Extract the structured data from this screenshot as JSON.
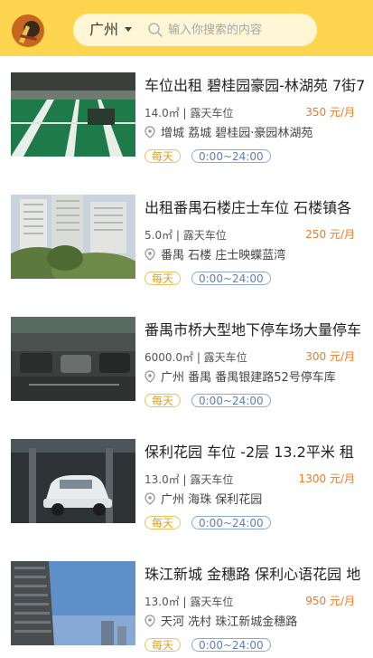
{
  "header": {
    "city": "广州",
    "search_placeholder": "输入你搜索的内容"
  },
  "colors": {
    "header_bg": "#fdd54f",
    "price": "#f07a22",
    "tag_day": "#e0a21c",
    "tag_time": "#5b7fbf"
  },
  "listings": [
    {
      "title": "车位出租 碧桂园豪园-林湖苑 7街7",
      "area": "14.0㎡",
      "type": "露天车位",
      "price": "350 元/月",
      "location": "增城  荔城  碧桂园·豪园林湖苑",
      "tag_day": "每天",
      "tag_time": "0:00~24:00"
    },
    {
      "title": "出租番禺石楼庄士车位 石楼镇各",
      "area": "5.0㎡",
      "type": "露天车位",
      "price": "250 元/月",
      "location": "番禺  石楼  庄士映蝶蓝湾",
      "tag_day": "每天",
      "tag_time": "0:00~24:00"
    },
    {
      "title": "番禺市桥大型地下停车场大量停车",
      "area": "6000.0㎡",
      "type": "露天车位",
      "price": "300 元/月",
      "location": "广州  番禺  番禺银建路52号停车库",
      "tag_day": "每天",
      "tag_time": "0:00~24:00"
    },
    {
      "title": "保利花园 车位 -2层 13.2平米 租",
      "area": "13.0㎡",
      "type": "露天车位",
      "price": "1300 元/月",
      "location": "广州  海珠  保利花园",
      "tag_day": "每天",
      "tag_time": "0:00~24:00"
    },
    {
      "title": "珠江新城 金穗路 保利心语花园 地",
      "area": "13.0㎡",
      "type": "露天车位",
      "price": "950 元/月",
      "location": "天河  冼村  珠江新城金穗路",
      "tag_day": "每天",
      "tag_time": "0:00~24:00"
    }
  ]
}
